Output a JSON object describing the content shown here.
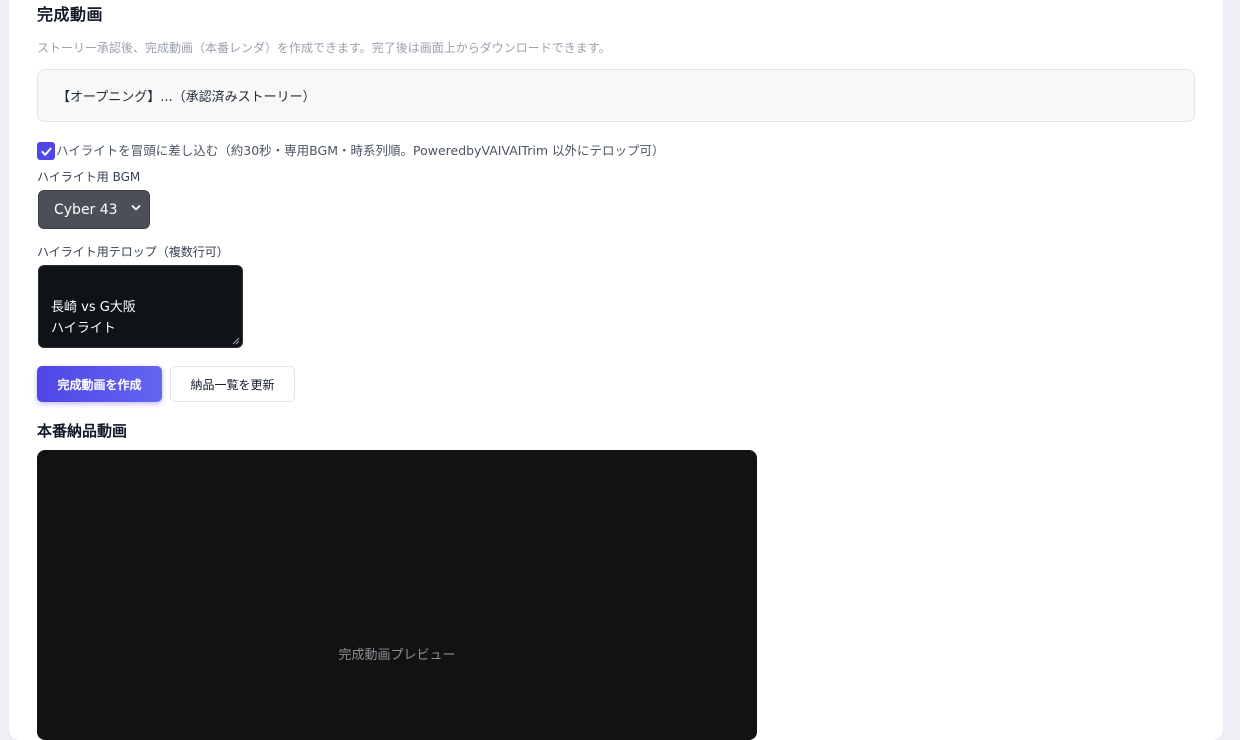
{
  "section": {
    "title": "完成動画",
    "description": "ストーリー承認後、完成動画（本番レンダ）を作成できます。完了後は画面上からダウンロードできます。"
  },
  "story": {
    "text": "【オープニング】...（承認済みストーリー）"
  },
  "highlight": {
    "checked": true,
    "checkbox_label": "ハイライトを冒頭に差し込む（約30秒・専用BGM・時系列順。PoweredbyVAIVAITrim 以外にテロップ可）",
    "bgm_label": "ハイライト用 BGM",
    "bgm_selected": "Cyber 43",
    "telop_label": "ハイライト用テロップ（複数行可）",
    "telop_value": "長崎 vs G大阪\nハイライト"
  },
  "actions": {
    "create_label": "完成動画を作成",
    "refresh_label": "納品一覧を更新"
  },
  "delivery": {
    "title": "本番納品動画",
    "preview_label": "完成動画プレビュー"
  },
  "colors": {
    "accent": "#4f46e5",
    "select_bg": "#4b4f57",
    "textarea_bg": "#0f1318",
    "video_bg": "#121212"
  }
}
